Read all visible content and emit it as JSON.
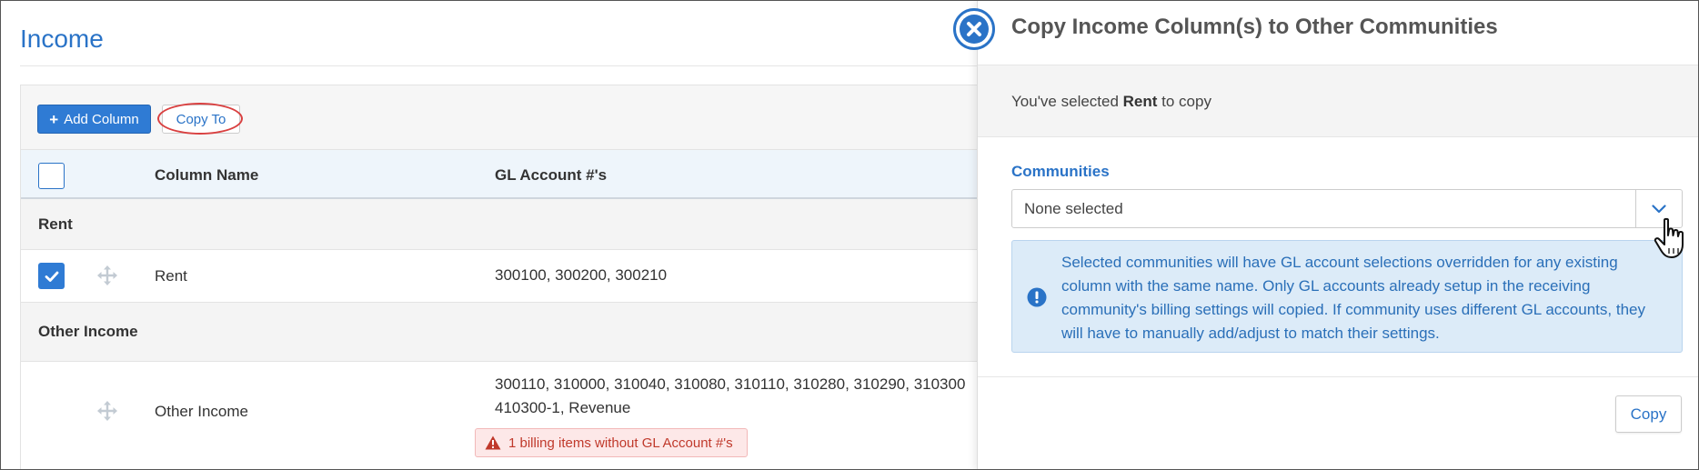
{
  "page": {
    "title": "Income"
  },
  "toolbar": {
    "add_column_label": "Add Column",
    "copy_to_label": "Copy To"
  },
  "table": {
    "columns": [
      "Column Name",
      "GL Account #'s"
    ],
    "groups": [
      {
        "name": "Rent",
        "rows": [
          {
            "name": "Rent",
            "gl": "300100, 300200, 300210",
            "checked": true
          }
        ]
      },
      {
        "name": "Other Income",
        "rows": [
          {
            "name": "Other Income",
            "gl_line1": "300110, 310000, 310040, 310080, 310110, 310280, 310290, 310300",
            "gl_line2": "410300-1, Revenue",
            "warning": "1 billing items without GL Account #'s",
            "checked": false
          }
        ]
      }
    ]
  },
  "drawer": {
    "title": "Copy Income Column(s) to Other Communities",
    "selected_prefix": "You've selected ",
    "selected_item": "Rent",
    "selected_suffix": " to copy",
    "communities_label": "Communities",
    "select_value": "None selected",
    "alert_text": "Selected communities will have GL account selections overridden for any existing column with the same name. Only GL accounts already setup in the receiving community's billing settings will copied. If community uses different GL accounts, they will have to manually add/adjust to match their settings.",
    "copy_label": "Copy"
  },
  "colors": {
    "accent": "#2a73c7",
    "primary_button": "#2f7bd4",
    "warning_text": "#c0392b",
    "info_bg": "#dcebf8",
    "highlight": "#d94040"
  },
  "icons": [
    "plus-icon",
    "checkmark-icon",
    "move-icon",
    "warning-triangle-icon",
    "close-icon",
    "chevron-down-icon",
    "info-exclamation-icon",
    "hand-cursor-icon"
  ]
}
